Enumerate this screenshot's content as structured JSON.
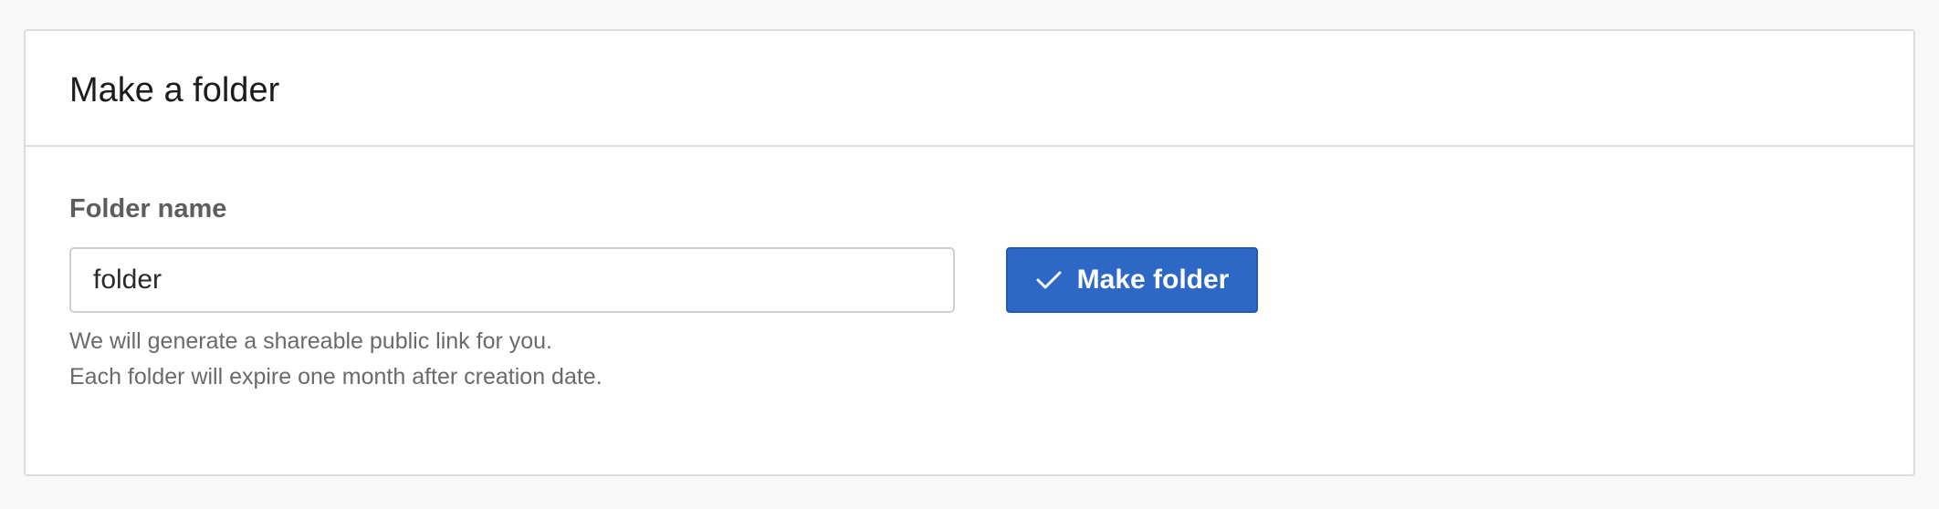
{
  "panel": {
    "title": "Make a folder"
  },
  "form": {
    "field_label": "Folder name",
    "folder_name_value": "folder",
    "help_lines": [
      "We will generate a shareable public link for you.",
      "Each folder will expire one month after creation date."
    ],
    "submit_label": "Make folder",
    "submit_icon": "checkmark-icon"
  },
  "colors": {
    "accent": "#2e68c6",
    "background": "#f8f8f8",
    "panel": "#ffffff"
  }
}
